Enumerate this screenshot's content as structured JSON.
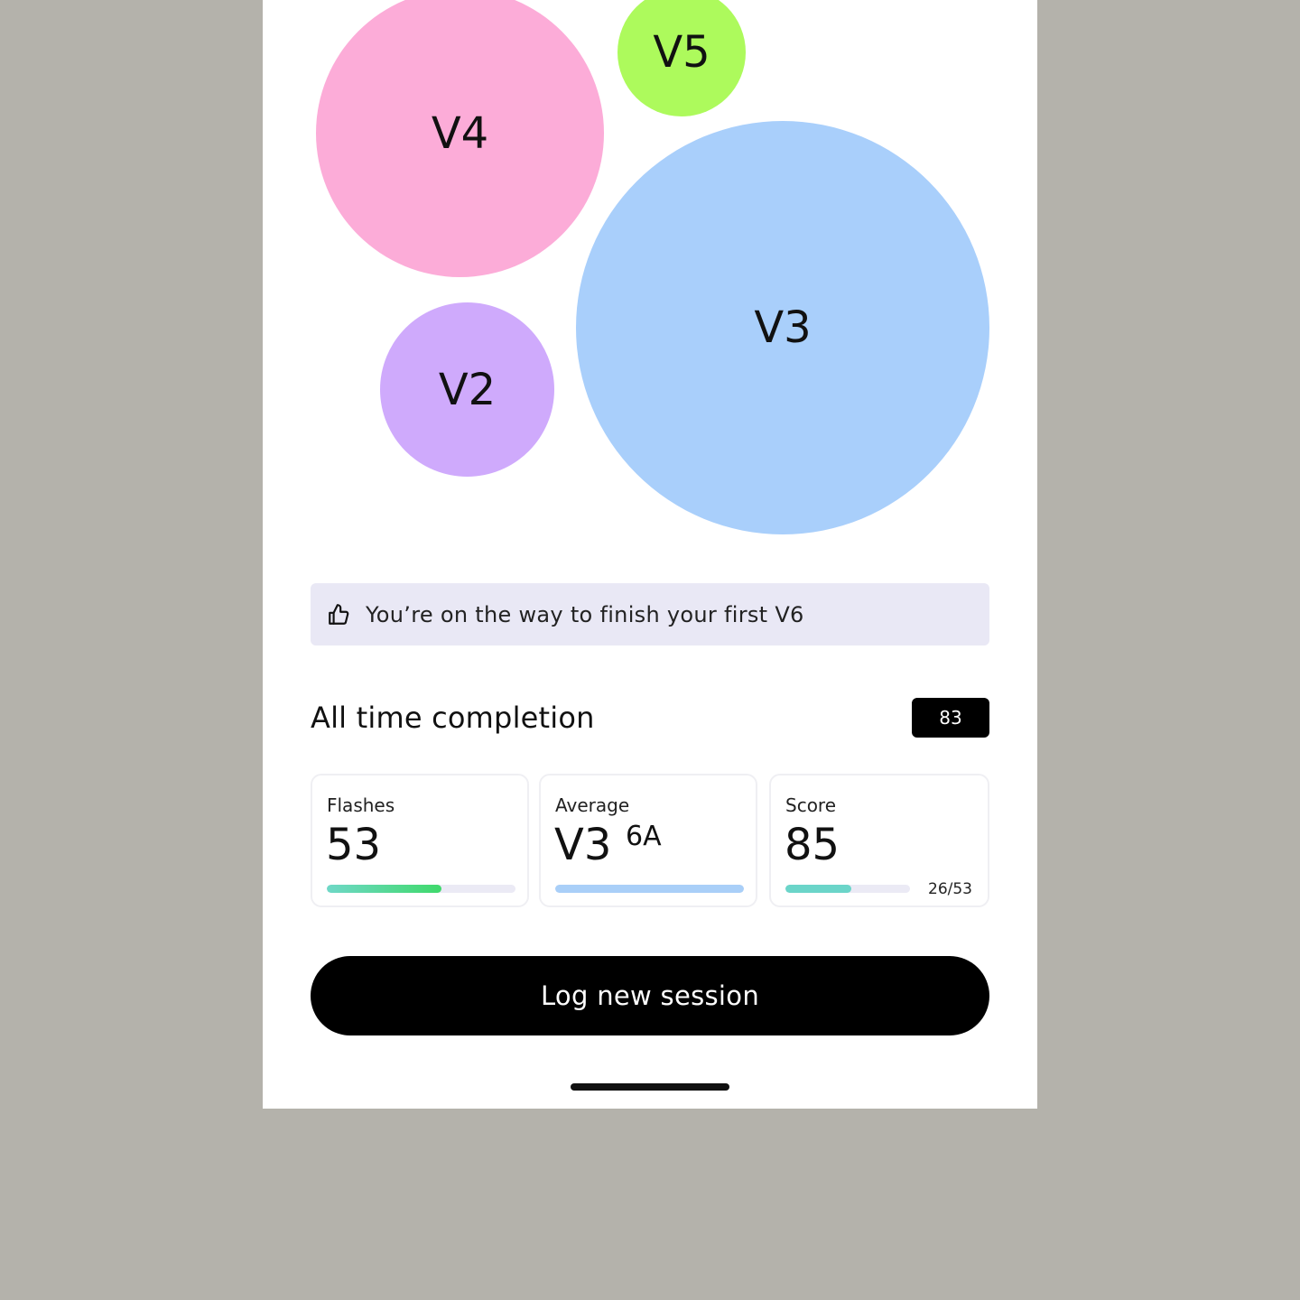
{
  "grade_bubbles": [
    {
      "label": "V4",
      "color": "#fcacd8"
    },
    {
      "label": "V5",
      "color": "#adfa5c"
    },
    {
      "label": "V3",
      "color": "#a9cffb"
    },
    {
      "label": "V2",
      "color": "#cfaafc"
    }
  ],
  "tip": {
    "icon": "thumbs-up-icon",
    "text": "You’re on the way to finish your first V6"
  },
  "completion": {
    "title": "All time completion",
    "count": "83"
  },
  "stats": {
    "flashes": {
      "label": "Flashes",
      "value": "53",
      "progress_pct": 61
    },
    "average": {
      "label": "Average",
      "value": "V3",
      "secondary": "6A",
      "progress_pct": 100
    },
    "score": {
      "label": "Score",
      "value": "85",
      "fraction": "26/53",
      "progress_pct": 53
    }
  },
  "cta": {
    "label": "Log new session"
  }
}
